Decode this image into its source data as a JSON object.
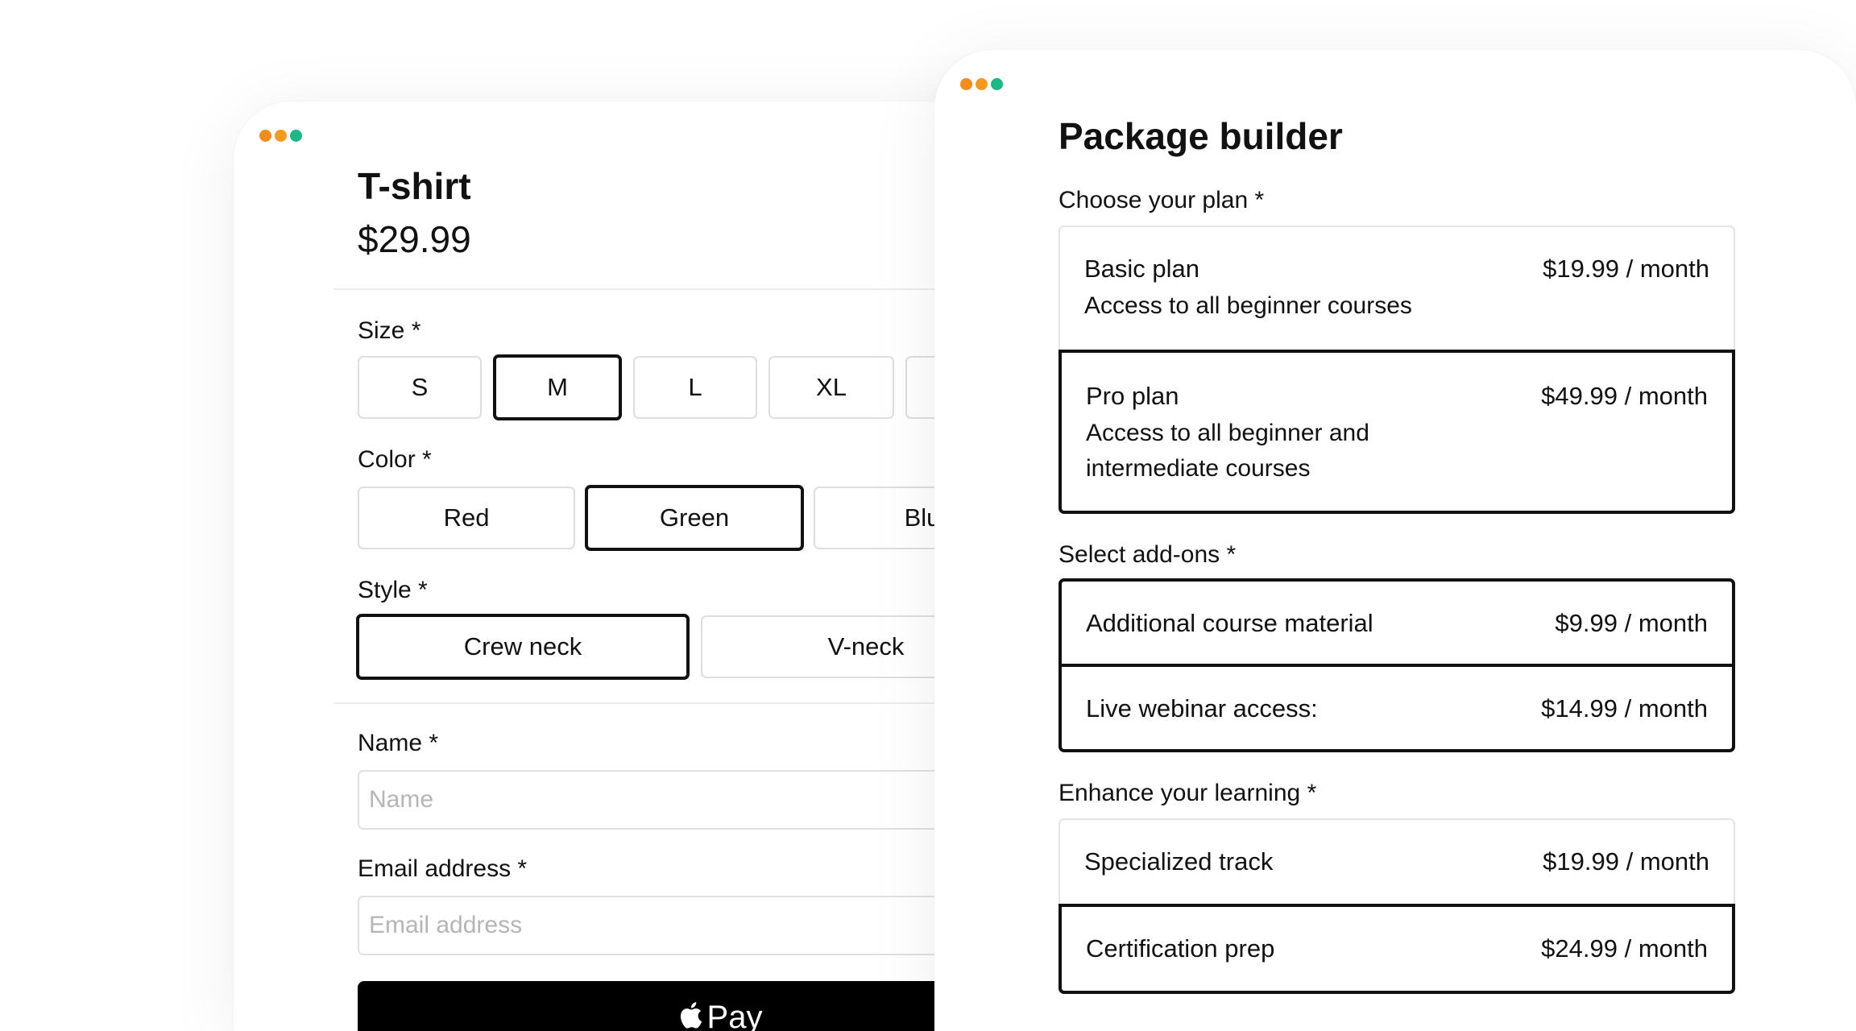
{
  "colors": {
    "dot_orange": "#f28c1c",
    "dot_orange_2": "#f59a1f",
    "dot_green": "#19b886",
    "selected_border": "#111111",
    "pay_button": "#000000"
  },
  "product": {
    "title": "T-shirt",
    "price": "$29.99",
    "size": {
      "label": "Size",
      "required": "*",
      "options": [
        "S",
        "M",
        "L",
        "XL",
        ""
      ],
      "selected": "M"
    },
    "color": {
      "label": "Color",
      "required": "*",
      "options": [
        "Red",
        "Green",
        "Blu"
      ],
      "selected": "Green"
    },
    "style": {
      "label": "Style",
      "required": "*",
      "options": [
        "Crew neck",
        "V-neck"
      ],
      "selected": "Crew neck"
    },
    "name": {
      "label": "Name",
      "required": "*",
      "placeholder": "Name",
      "value": ""
    },
    "email": {
      "label": "Email address",
      "required": "*",
      "placeholder": "Email address",
      "value": ""
    },
    "pay_button": {
      "icon": "apple-icon",
      "label": "Pay"
    }
  },
  "package": {
    "title": "Package builder",
    "plan": {
      "label": "Choose your plan",
      "required": "*",
      "options": [
        {
          "name": "Basic plan",
          "price": "$19.99 / month",
          "description": "Access to all beginner courses",
          "selected": false
        },
        {
          "name": "Pro plan",
          "price": "$49.99 / month",
          "description": "Access to all beginner and intermediate courses",
          "selected": true
        }
      ]
    },
    "addons": {
      "label": "Select add-ons",
      "required": "*",
      "options": [
        {
          "name": "Additional course material",
          "price": "$9.99 / month",
          "selected": true
        },
        {
          "name": "Live webinar access:",
          "price": "$14.99 / month",
          "selected": true
        }
      ]
    },
    "enhance": {
      "label": "Enhance your learning",
      "required": "*",
      "options": [
        {
          "name": "Specialized track",
          "price": "$19.99 / month",
          "selected": false
        },
        {
          "name": "Certification prep",
          "price": "$24.99 / month",
          "selected": true
        }
      ]
    }
  }
}
